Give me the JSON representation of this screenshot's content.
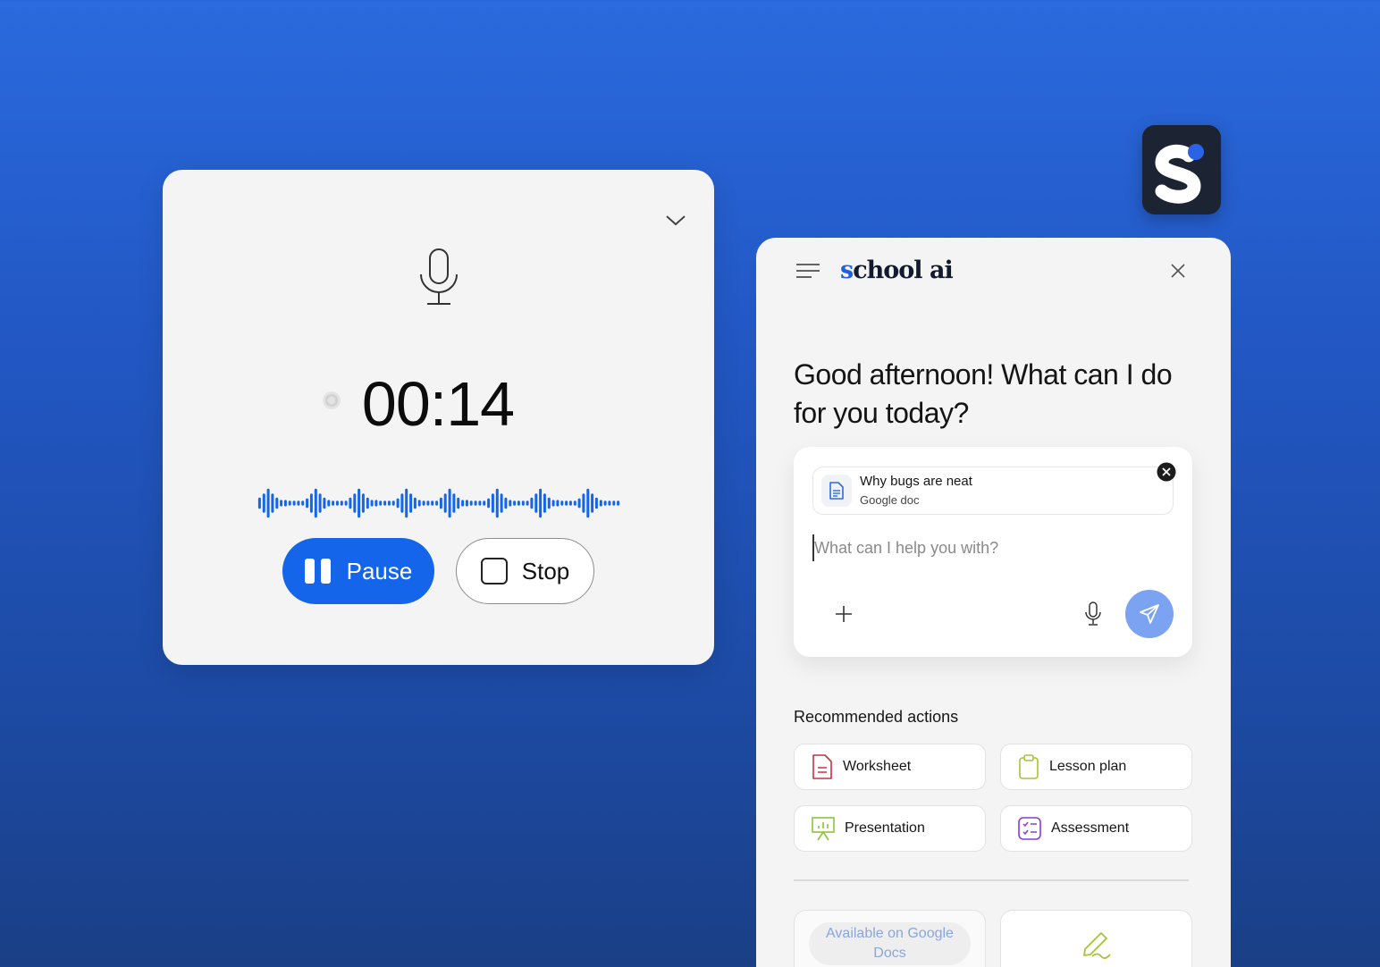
{
  "recorder": {
    "timer": "00:14",
    "pause_label": "Pause",
    "stop_label": "Stop",
    "accent_color": "#1465ea"
  },
  "app_icon": {
    "name": "schoolai-app-icon",
    "letter": "S"
  },
  "panel": {
    "brand": {
      "prefix": "s",
      "rest": "chool ai"
    },
    "greeting": "Good afternoon! What can I do for you today?",
    "attachment": {
      "title": "Why bugs are neat",
      "subtitle": "Google doc"
    },
    "prompt_placeholder": "What can I help you with?",
    "recommended_heading": "Recommended actions",
    "actions": [
      {
        "label": "Worksheet",
        "icon": "worksheet-icon",
        "color": "#c8323c"
      },
      {
        "label": "Lesson plan",
        "icon": "clipboard-icon",
        "color": "#a6c23a"
      },
      {
        "label": "Presentation",
        "icon": "presentation-icon",
        "color": "#8cc43a"
      },
      {
        "label": "Assessment",
        "icon": "checklist-icon",
        "color": "#8a3ad6"
      }
    ],
    "available_badge": "Available on Google Docs",
    "send_color": "#7ba3f1"
  }
}
